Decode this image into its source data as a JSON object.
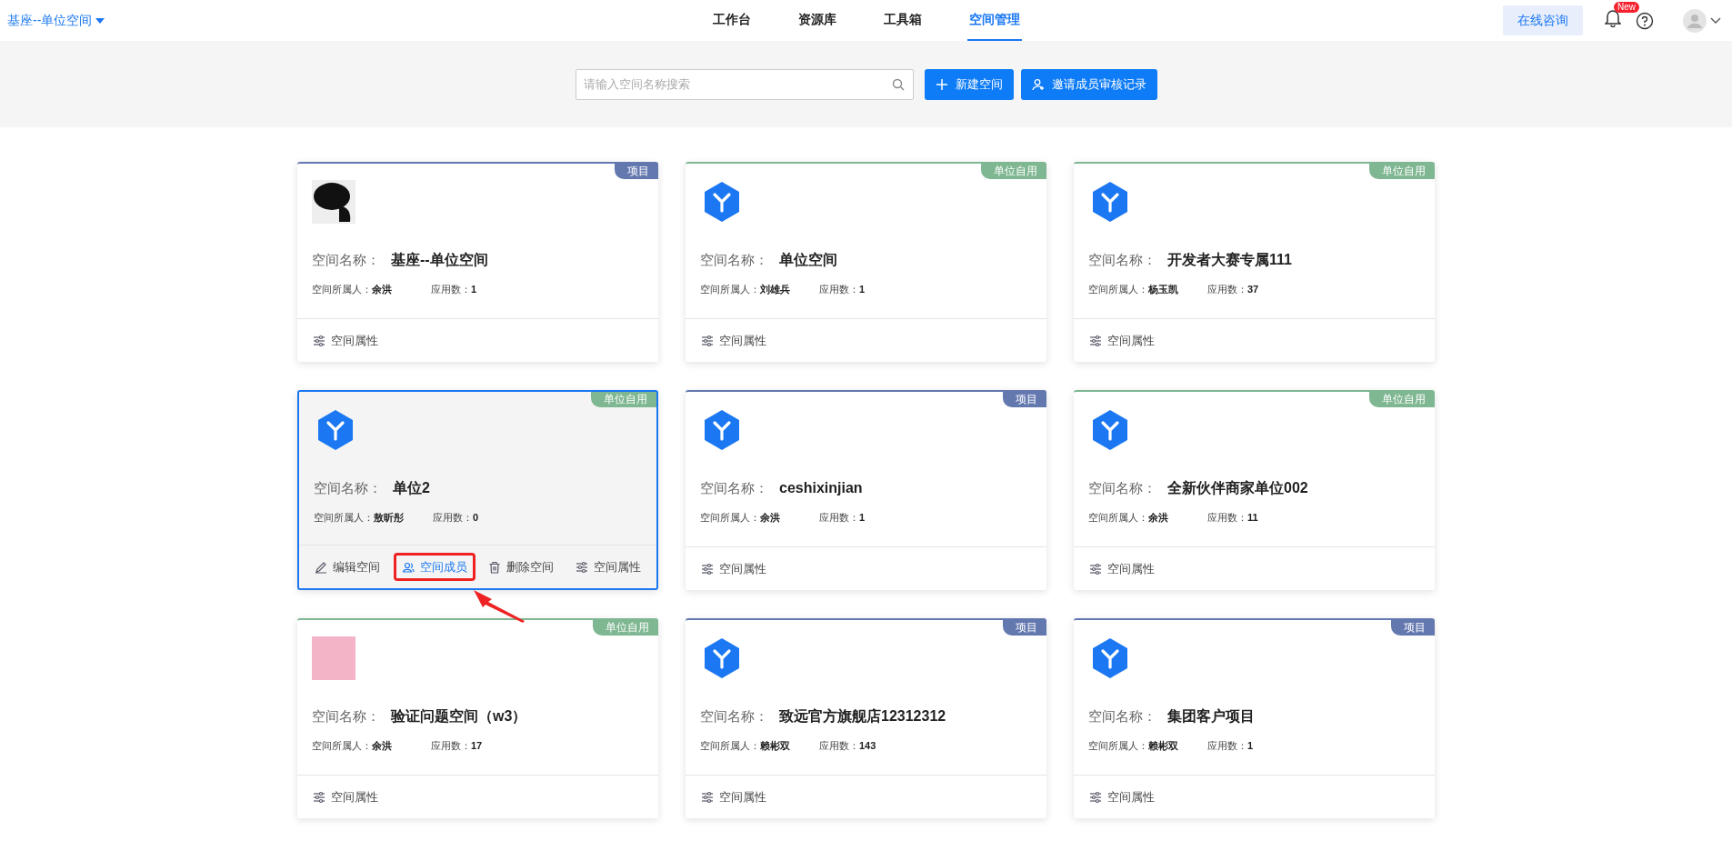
{
  "header": {
    "space_switcher": "基座--单位空间",
    "tabs": [
      {
        "label": "工作台",
        "selected": false
      },
      {
        "label": "资源库",
        "selected": false
      },
      {
        "label": "工具箱",
        "selected": false
      },
      {
        "label": "空间管理",
        "selected": true
      }
    ],
    "consult_button": "在线咨询",
    "notification_badge": "New"
  },
  "toolbar": {
    "search": {
      "placeholder": "请输入空间名称搜索"
    },
    "buttons": [
      {
        "kind": "add",
        "label": "新建空间"
      },
      {
        "kind": "invite",
        "label": "邀请成员审核记录"
      }
    ]
  },
  "cards": [
    {
      "tag": "项目",
      "color": "#6478b0",
      "kind": "logo",
      "hovered": false,
      "name_label": "空间名称：",
      "name": "基座--单位空间",
      "owner_label": "空间所属人：",
      "owner": "余洪",
      "apps_label": "应用数：",
      "apps": "1",
      "actions": [
        {
          "kind": "properties",
          "label": "空间属性",
          "highlighted": false
        }
      ]
    },
    {
      "tag": "单位自用",
      "color": "#7fb792",
      "kind": "default",
      "hovered": false,
      "name_label": "空间名称：",
      "name": "单位空间",
      "owner_label": "空间所属人：",
      "owner": "刘雄兵",
      "apps_label": "应用数：",
      "apps": "1",
      "actions": [
        {
          "kind": "properties",
          "label": "空间属性",
          "highlighted": false
        }
      ]
    },
    {
      "tag": "单位自用",
      "color": "#7fb792",
      "kind": "default",
      "hovered": false,
      "name_label": "空间名称：",
      "name": "开发者大赛专属111",
      "owner_label": "空间所属人：",
      "owner": "杨玉凯",
      "apps_label": "应用数：",
      "apps": "37",
      "actions": [
        {
          "kind": "properties",
          "label": "空间属性",
          "highlighted": false
        }
      ]
    },
    {
      "tag": "单位自用",
      "color": "#7fb792",
      "kind": "default",
      "hovered": true,
      "name_label": "空间名称：",
      "name": "单位2",
      "owner_label": "空间所属人：",
      "owner": "敖昕彤",
      "apps_label": "应用数：",
      "apps": "0",
      "actions": [
        {
          "kind": "edit",
          "label": "编辑空间",
          "highlighted": false
        },
        {
          "kind": "members",
          "label": "空间成员",
          "highlighted": true
        },
        {
          "kind": "delete",
          "label": "删除空间",
          "highlighted": false
        },
        {
          "kind": "properties",
          "label": "空间属性",
          "highlighted": false
        }
      ]
    },
    {
      "tag": "项目",
      "color": "#6478b0",
      "kind": "default",
      "hovered": false,
      "name_label": "空间名称：",
      "name": "ceshixinjian",
      "owner_label": "空间所属人：",
      "owner": "余洪",
      "apps_label": "应用数：",
      "apps": "1",
      "actions": [
        {
          "kind": "properties",
          "label": "空间属性",
          "highlighted": false
        }
      ]
    },
    {
      "tag": "单位自用",
      "color": "#7fb792",
      "kind": "default",
      "hovered": false,
      "name_label": "空间名称：",
      "name": "全新伙伴商家单位002",
      "owner_label": "空间所属人：",
      "owner": "余洪",
      "apps_label": "应用数：",
      "apps": "11",
      "actions": [
        {
          "kind": "properties",
          "label": "空间属性",
          "highlighted": false
        }
      ]
    },
    {
      "tag": "单位自用",
      "color": "#7fb792",
      "kind": "photo",
      "hovered": false,
      "name_label": "空间名称：",
      "name": "验证问题空间（w3）",
      "owner_label": "空间所属人：",
      "owner": "余洪",
      "apps_label": "应用数：",
      "apps": "17",
      "actions": [
        {
          "kind": "properties",
          "label": "空间属性",
          "highlighted": false
        }
      ]
    },
    {
      "tag": "项目",
      "color": "#6478b0",
      "kind": "default",
      "hovered": false,
      "name_label": "空间名称：",
      "name": "致远官方旗舰店12312312",
      "owner_label": "空间所属人：",
      "owner": "赖彬双",
      "apps_label": "应用数：",
      "apps": "143",
      "actions": [
        {
          "kind": "properties",
          "label": "空间属性",
          "highlighted": false
        }
      ]
    },
    {
      "tag": "项目",
      "color": "#6478b0",
      "kind": "default",
      "hovered": false,
      "name_label": "空间名称：",
      "name": "集团客户项目",
      "owner_label": "空间所属人：",
      "owner": "赖彬双",
      "apps_label": "应用数：",
      "apps": "1",
      "actions": [
        {
          "kind": "properties",
          "label": "空间属性",
          "highlighted": false
        }
      ]
    }
  ]
}
